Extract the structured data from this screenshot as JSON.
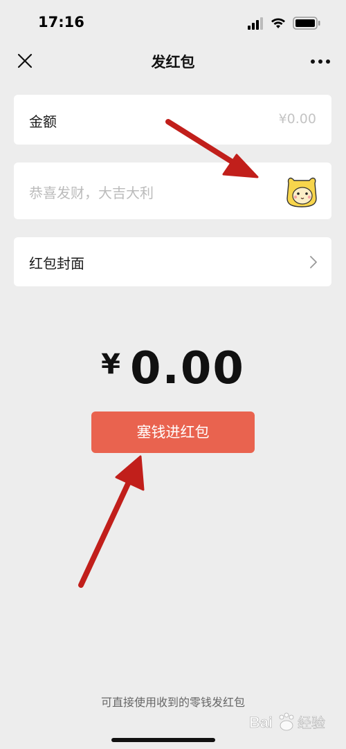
{
  "status_bar": {
    "time": "17:16",
    "icons": [
      "signal-icon",
      "wifi-icon",
      "battery-icon"
    ]
  },
  "nav": {
    "title": "发红包",
    "close_icon": "close-icon",
    "more_icon": "more-icon"
  },
  "amount_field": {
    "label": "金额",
    "value": "¥0.00"
  },
  "greeting_field": {
    "placeholder": "恭喜发财，大吉大利",
    "emoji_icon": "emoji-sticker-icon"
  },
  "cover_row": {
    "label": "红包封面",
    "chevron_icon": "chevron-right-icon"
  },
  "total": {
    "currency": "¥",
    "value": "0.00"
  },
  "submit": {
    "label": "塞钱进红包"
  },
  "footer": {
    "note": "可直接使用收到的零钱发红包"
  },
  "watermark": {
    "text": "Bai 经验"
  },
  "colors": {
    "background": "#ededed",
    "button": "#e9634f",
    "arrow": "#c11f1b"
  }
}
